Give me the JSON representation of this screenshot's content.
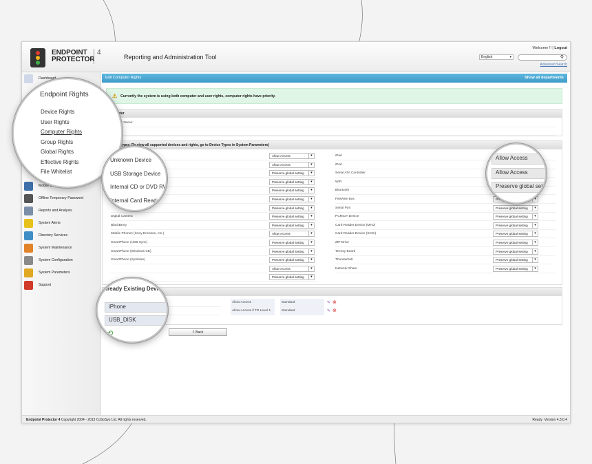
{
  "header": {
    "logo_line1": "ENDPOINT",
    "logo_line2": "PROTECTOR",
    "logo_version": "4",
    "app_title": "Reporting and Administration Tool",
    "welcome": "Welcome !! |",
    "logout": "Logout",
    "language": "English",
    "advanced_search": "Advanced Search"
  },
  "sidebar": {
    "items": [
      {
        "label": "Dashboard",
        "icon": "dashboard-icon"
      },
      {
        "label": "Mobile Device Management",
        "icon": "mobile-icon"
      },
      {
        "label": "Offline Temporary Password",
        "icon": "password-icon"
      },
      {
        "label": "Reports and Analysis",
        "icon": "reports-icon"
      },
      {
        "label": "System Alerts",
        "icon": "alert-icon"
      },
      {
        "label": "Directory Services",
        "icon": "directory-icon"
      },
      {
        "label": "System Maintenance",
        "icon": "maintenance-icon"
      },
      {
        "label": "System Configuration",
        "icon": "configuration-icon"
      },
      {
        "label": "System Parameters",
        "icon": "parameters-icon"
      },
      {
        "label": "Support",
        "icon": "support-icon"
      }
    ]
  },
  "main": {
    "title": "Edit Computer Rights",
    "show_all": "Show all departments",
    "notice": "Currently the system is using both computer and user rights, computer rights have priority.",
    "computer_header": "Computer",
    "computer_name_label": "Computer Name:",
    "location_label": "Location:",
    "device_types_header": "Device Types (To view all supported devices and rights, go to Device Types in System Parameters)",
    "left_devices": [
      {
        "name": "Unknown Device",
        "right": "Allow Access"
      },
      {
        "name": "USB Storage Device",
        "right": "Allow Access"
      },
      {
        "name": "Internal CD or DVD RW",
        "right": "Preserve global setting"
      },
      {
        "name": "Internal Card Reader",
        "right": "Preserve global setting"
      },
      {
        "name": "",
        "right": "Preserve global setting"
      },
      {
        "name": "",
        "right": "Preserve global setting"
      },
      {
        "name": "",
        "right": "Preserve global setting"
      },
      {
        "name": "Digital Camera",
        "right": "Preserve global setting"
      },
      {
        "name": "BlackBerry",
        "right": "Preserve global setting"
      },
      {
        "name": "Mobile Phones (Sony Ericsson, etc.)",
        "right": "Allow Access"
      },
      {
        "name": "SmartPhone (USB Sync)",
        "right": "Preserve global setting"
      },
      {
        "name": "SmartPhone (Windows CE)",
        "right": "Preserve global setting"
      },
      {
        "name": "SmartPhone (Symbian)",
        "right": "Preserve global setting"
      },
      {
        "name": "",
        "right": "Allow Access"
      },
      {
        "name": "",
        "right": "Preserve global setting"
      }
    ],
    "right_devices": [
      {
        "name": "iPad",
        "right": "Allow Access"
      },
      {
        "name": "iPod",
        "right": "Allow Access"
      },
      {
        "name": "Serial ATA Controller",
        "right": "Preserve global setting"
      },
      {
        "name": "WiFi",
        "right": "Preserve global setting"
      },
      {
        "name": "Bluetooth",
        "right": "Preserve global setting"
      },
      {
        "name": "FireWire Bus",
        "right": "Preserve global setting"
      },
      {
        "name": "Serial Port",
        "right": "Preserve global setting"
      },
      {
        "name": "PCMCIA Device",
        "right": "Preserve global setting"
      },
      {
        "name": "Card Reader Device (MTD)",
        "right": "Preserve global setting"
      },
      {
        "name": "Card Reader Device (SCSI)",
        "right": "Preserve global setting"
      },
      {
        "name": "ZIP Drive",
        "right": "Preserve global setting"
      },
      {
        "name": "Teensy Board",
        "right": "Preserve global setting"
      },
      {
        "name": "Thunderbolt",
        "right": "Preserve global setting"
      },
      {
        "name": "Network Share",
        "right": "Preserve global setting"
      }
    ],
    "existing_header": "Already Existing Devices",
    "existing": [
      {
        "device": "iPhone",
        "right": "Allow Access",
        "level": "Standard"
      },
      {
        "device": "USB_DISK",
        "right": "Allow Access if TD Level 1",
        "level": "Standard"
      }
    ],
    "back_label": "Back"
  },
  "footer": {
    "product": "Endpoint Protector 4",
    "copyright": "Copyright 2004 - 2013 CoSoSys Ltd. All rights reserved.",
    "status": "Ready",
    "version": "Version 4.3.0.4"
  },
  "magnifier_menu": {
    "title": "Endpoint Rights",
    "items": [
      "Device Rights",
      "User Rights",
      "Computer Rights",
      "Group Rights",
      "Global Rights",
      "Effective Rights",
      "File Whitelist"
    ]
  },
  "magnifier_devices": [
    "Unknown Device",
    "USB Storage Device",
    "Internal CD or DVD RW",
    "Internal Card Reader"
  ],
  "magnifier_rights": [
    "Allow Access",
    "Allow Access",
    "Preserve global setting"
  ],
  "magnifier_existing": {
    "title": "Already Existing Devices",
    "items": [
      "iPhone",
      "USB_DISK"
    ]
  }
}
